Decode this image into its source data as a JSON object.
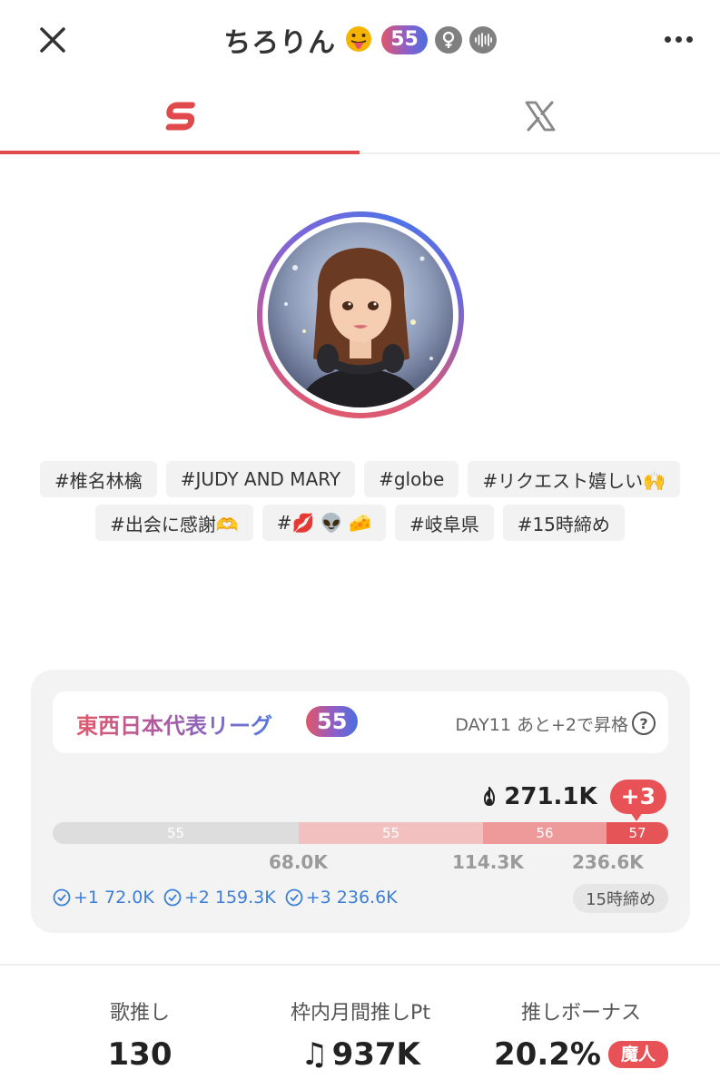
{
  "header": {
    "title": "ちろりん",
    "level": "55",
    "icons": [
      "close-icon",
      "tongue-emoji",
      "female-icon",
      "voice-icon",
      "more-icon"
    ]
  },
  "tabs": [
    {
      "name": "streaming-app",
      "icon": "app-logo-icon",
      "active": true
    },
    {
      "name": "x",
      "icon": "x-logo-icon",
      "active": false
    }
  ],
  "tags": [
    "#椎名林檎",
    "#JUDY AND MARY",
    "#globe",
    "#リクエスト嬉しい🙌",
    "#出会に感謝🫶",
    "#💋 👽 🧀",
    "#岐阜県",
    "#15時締め"
  ],
  "league": {
    "name": "東西日本代表リーグ",
    "level": "55",
    "status": "DAY11 あと+2で昇格",
    "help": "?",
    "score": "271.1K",
    "rank_change": "+3",
    "progress": [
      {
        "label": "55",
        "fraction": 0.4,
        "color": "#dddddd"
      },
      {
        "label": "55",
        "fraction": 0.3,
        "color": "#f3c0c0"
      },
      {
        "label": "56",
        "fraction": 0.2,
        "color": "#ee9a9b"
      },
      {
        "label": "57",
        "fraction": 0.1,
        "color": "#e55558"
      }
    ],
    "ticks": [
      "68.0K",
      "114.3K",
      "236.6K"
    ],
    "goals": [
      "+1 72.0K",
      "+2 159.3K",
      "+3 236.6K"
    ],
    "deadline": "15時締め"
  },
  "stats": [
    {
      "label": "歌推し",
      "value": "130"
    },
    {
      "label": "枠内月間推しPt",
      "value": "937K",
      "prefix": "♫"
    },
    {
      "label": "推しボーナス",
      "value": "20.2%",
      "badge": "魔人"
    }
  ],
  "colors": {
    "accent": "#e04a4d",
    "goal_blue": "#3d7fd8"
  }
}
